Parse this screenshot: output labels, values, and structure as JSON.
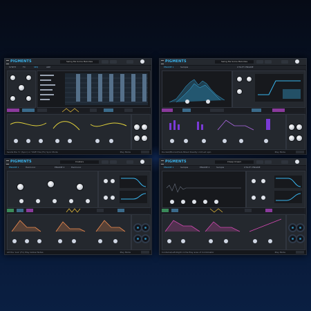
{
  "app": {
    "title": "PIGMENTS",
    "accent": "#39b6f0",
    "secondary": "#d14ad6",
    "menu_icon": "hamburger-icon"
  },
  "windows": [
    {
      "preset": "Swing Me Some Melodies",
      "tabs": [
        "SYNTH",
        "FX",
        "SEQ",
        "ARP"
      ],
      "status": "Sends the '1' (Sync) or 'Shift' the (Fn) Sync Mode",
      "playmode": "Play Mode"
    },
    {
      "preset": "Swing Me Some Melodies",
      "tabs": [
        "ENGINE 1",
        "Sample",
        "UTILITY ENGINE"
      ],
      "status": "Ducked/Blurred/Sub-Mixed Deadly I-Oct-ed spin",
      "playmode": "Play Mode"
    },
    {
      "preset": "Clusters",
      "tabs": [
        "ENGINE 1",
        "Harmonic",
        "ENGINE 2",
        "Harmonic"
      ],
      "status": "Alt the 'Aux' (Fn) Play Global Notes",
      "playmode": "Play Mode"
    },
    {
      "preset": "Cheap Dream",
      "tabs": [
        "ENGINE 1",
        "Sample",
        "ENGINE 2",
        "Sample",
        "UTILITY ENGINE"
      ],
      "status": "Contains/Left-Right in the Play area of Combinator",
      "playmode": "Play Mode"
    }
  ]
}
